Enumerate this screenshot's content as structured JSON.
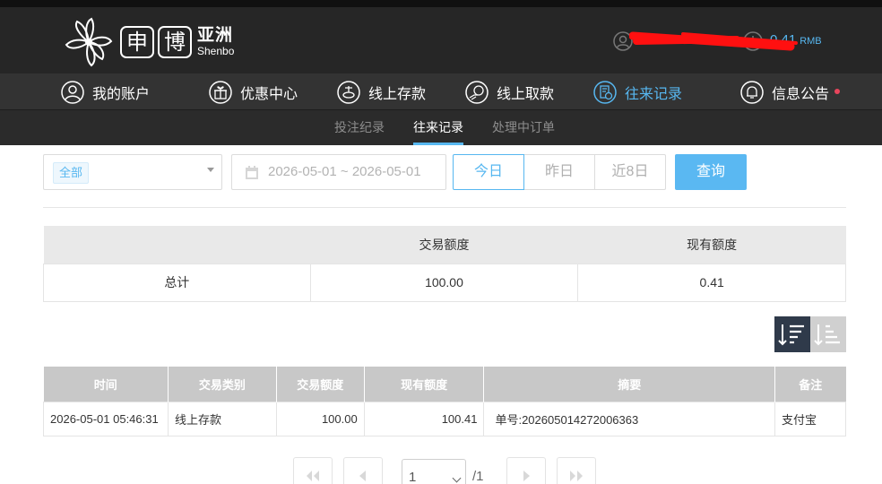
{
  "header": {
    "logo": {
      "box1": "申",
      "box2": "博",
      "cn": "亚洲",
      "en": "Shenbo"
    },
    "balance": {
      "amount": "0.41",
      "currency": "RMB"
    }
  },
  "nav": [
    {
      "label": "我的账户",
      "icon": "user-icon"
    },
    {
      "label": "优惠中心",
      "icon": "gift-icon"
    },
    {
      "label": "线上存款",
      "icon": "deposit-icon"
    },
    {
      "label": "线上取款",
      "icon": "withdraw-icon"
    },
    {
      "label": "往来记录",
      "icon": "records-icon",
      "active": true
    },
    {
      "label": "信息公告",
      "icon": "bell-icon",
      "badge": true
    }
  ],
  "subnav": [
    {
      "label": "投注纪录"
    },
    {
      "label": "往来记录",
      "active": true
    },
    {
      "label": "处理中订单"
    }
  ],
  "filter": {
    "type_value": "全部",
    "date_range": "2026-05-01 ~ 2026-05-01",
    "ranges": [
      "今日",
      "昨日",
      "近8日"
    ],
    "query_label": "查询"
  },
  "summary": {
    "headers": [
      "",
      "交易额度",
      "现有额度"
    ],
    "row": [
      "总计",
      "100.00",
      "0.41"
    ]
  },
  "records": {
    "headers": [
      "时间",
      "交易类别",
      "交易额度",
      "现有额度",
      "摘要",
      "备注"
    ],
    "rows": [
      [
        "2026-05-01 05:46:31",
        "线上存款",
        "100.00",
        "100.41",
        "单号:202605014272006363",
        "支付宝"
      ]
    ]
  },
  "pager": {
    "page": "1",
    "total": "/1"
  },
  "colors": {
    "accent": "#57b7f0",
    "header_bg": "#262626",
    "nav_bg": "#333333",
    "badge": "#e8455c"
  }
}
